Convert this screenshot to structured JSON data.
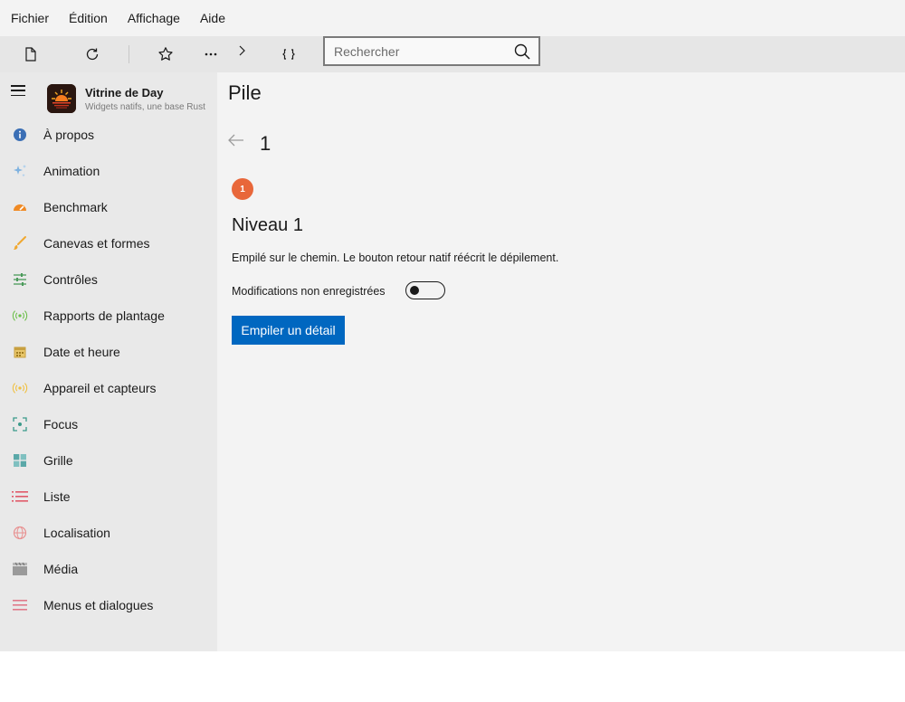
{
  "menu": {
    "items": [
      "Fichier",
      "Édition",
      "Affichage",
      "Aide"
    ]
  },
  "toolbar": {
    "buttons": [
      "new-file-icon",
      "refresh-icon",
      "star-icon",
      "more-icon",
      "chevron-right-icon",
      "braces-icon"
    ],
    "search": {
      "placeholder": "Rechercher",
      "value": ""
    }
  },
  "sidebar": {
    "app_title": "Vitrine de Day",
    "app_subtitle": "Widgets natifs, une base Rust",
    "items": [
      {
        "label": "À propos",
        "icon": "info-icon",
        "color": "#3b6fb5"
      },
      {
        "label": "Animation",
        "icon": "sparkle-icon",
        "color": "#7fb2e0"
      },
      {
        "label": "Benchmark",
        "icon": "gauge-icon",
        "color": "#f08a24"
      },
      {
        "label": "Canevas et formes",
        "icon": "brush-icon",
        "color": "#f0a830"
      },
      {
        "label": "Contrôles",
        "icon": "sliders-icon",
        "color": "#4a9a5a"
      },
      {
        "label": "Rapports de plantage",
        "icon": "broadcast-icon",
        "color": "#6cc04a"
      },
      {
        "label": "Date et heure",
        "icon": "calendar-icon",
        "color": "#c8a040"
      },
      {
        "label": "Appareil et capteurs",
        "icon": "sensor-icon",
        "color": "#f0c040"
      },
      {
        "label": "Focus",
        "icon": "focus-icon",
        "color": "#3a9a8a"
      },
      {
        "label": "Grille",
        "icon": "grid-icon",
        "color": "#5aa8a8"
      },
      {
        "label": "Liste",
        "icon": "list-icon",
        "color": "#e05a6a"
      },
      {
        "label": "Localisation",
        "icon": "globe-icon",
        "color": "#e89090"
      },
      {
        "label": "Média",
        "icon": "clapper-icon",
        "color": "#9a9a9a"
      },
      {
        "label": "Menus et dialogues",
        "icon": "menu-lines-icon",
        "color": "#e07a8a"
      }
    ]
  },
  "main": {
    "page_title": "Pile",
    "level_number": "1",
    "badge": "1",
    "badge_color": "#e8673a",
    "heading": "Niveau 1",
    "description": "Empilé sur le chemin. Le bouton retour natif réécrit le dépilement.",
    "toggle_label": "Modifications non enregistrées",
    "toggle_on": false,
    "push_button": "Empiler un détail",
    "accent_color": "#0067c0"
  }
}
